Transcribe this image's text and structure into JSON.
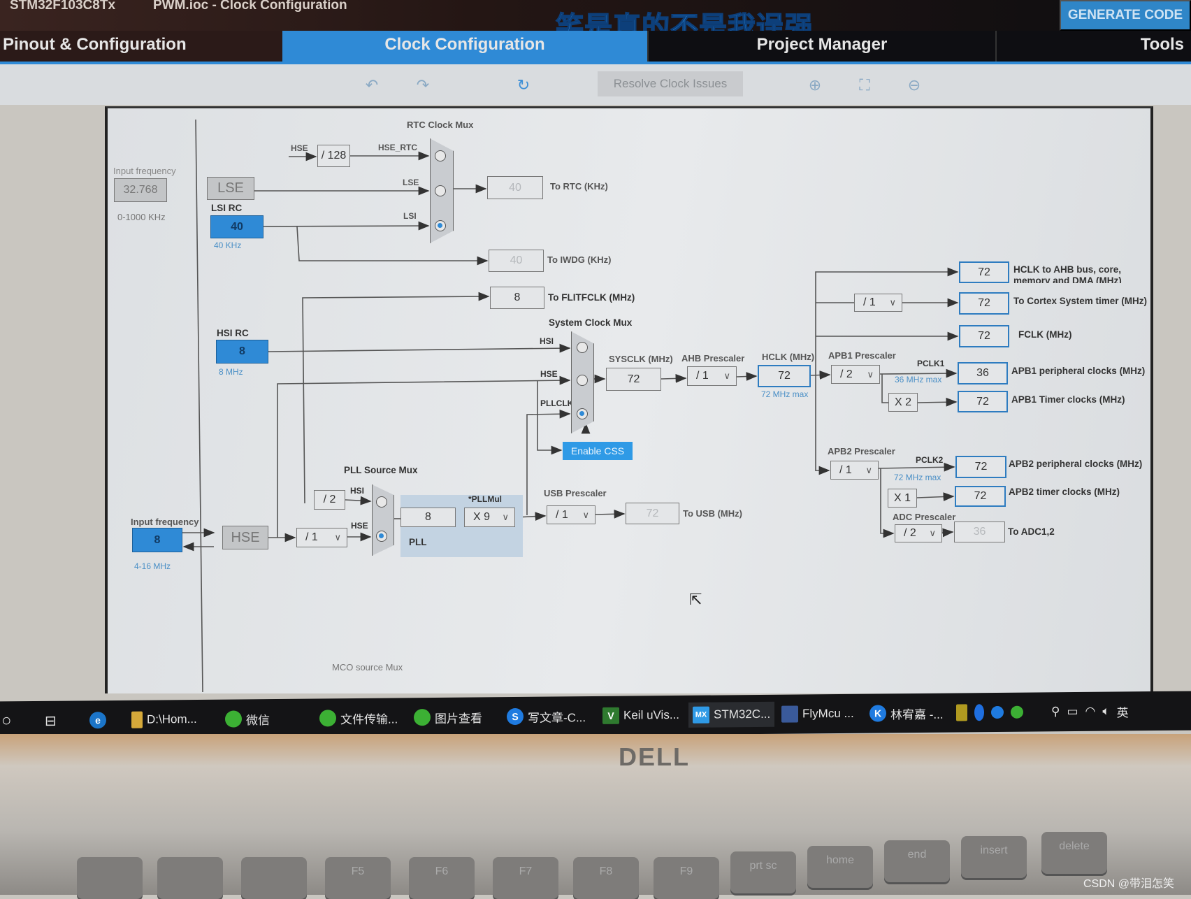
{
  "window": {
    "breadcrumb": [
      "STM32F103C8Tx",
      "PWM.ioc - Clock Configuration"
    ],
    "generate_code": "GENERATE CODE",
    "overlay_caption": "笑是真的不是我逞强"
  },
  "tabs": [
    {
      "label": "Pinout & Configuration",
      "active": false
    },
    {
      "label": "Clock Configuration",
      "active": true
    },
    {
      "label": "Project Manager",
      "active": false
    },
    {
      "label": "Tools",
      "active": false
    }
  ],
  "toolbar": {
    "icons": [
      "undo-icon",
      "redo-icon",
      "refresh-icon",
      "zoom-in-icon",
      "fit-screen-icon",
      "zoom-out-icon"
    ],
    "resolve_label": "Resolve Clock Issues"
  },
  "diagram": {
    "lse_input": {
      "label": "Input frequency",
      "value": "32.768",
      "range": "0-1000 KHz",
      "block": "LSE"
    },
    "lsi": {
      "label": "LSI RC",
      "value": "40",
      "unit": "40 KHz"
    },
    "rtc_mux": {
      "label": "RTC Clock Mux",
      "hse_label": "HSE",
      "div": "/ 128",
      "hse_rtc": "HSE_RTC",
      "lse_label": "LSE",
      "lsi_label": "LSI",
      "selected": "LSI"
    },
    "rtc_out": {
      "value": "40",
      "label": "To RTC (KHz)"
    },
    "iwdg_out": {
      "value": "40",
      "label": "To IWDG (KHz)"
    },
    "flitf_out": {
      "value": "8",
      "label": "To FLITFCLK (MHz)"
    },
    "hsi": {
      "label": "HSI RC",
      "value": "8",
      "unit": "8 MHz"
    },
    "sys_mux": {
      "label": "System Clock Mux",
      "hsi": "HSI",
      "hse": "HSE",
      "pllclk": "PLLCLK",
      "selected": "PLLCLK"
    },
    "sysclk": {
      "label": "SYSCLK (MHz)",
      "value": "72"
    },
    "ahb": {
      "label": "AHB Prescaler",
      "value": "/ 1"
    },
    "hclk": {
      "label": "HCLK (MHz)",
      "value": "72",
      "max": "72 MHz max"
    },
    "enable_css": "Enable CSS",
    "pll_src": {
      "label": "PLL Source Mux",
      "hsi": "HSI",
      "hse": "HSE",
      "hsi_div": "/ 2",
      "selected": "HSE"
    },
    "pll": {
      "label": "PLL",
      "input": "8",
      "mul_label": "*PLLMul",
      "mul": "X 9"
    },
    "usb": {
      "label": "USB Prescaler",
      "value": "/ 1",
      "out": "72",
      "out_label": "To USB (MHz)"
    },
    "hse_input": {
      "label": "Input frequency",
      "value": "8",
      "range": "4-16 MHz",
      "block": "HSE",
      "div": "/ 1"
    },
    "mco_label": "MCO source Mux",
    "outputs": {
      "ahb": {
        "value": "72",
        "label1": "HCLK to AHB bus, core,",
        "label2": "memory and DMA (MHz)"
      },
      "cortex": {
        "div": "/ 1",
        "value": "72",
        "label": "To Cortex System timer (MHz)"
      },
      "fclk": {
        "value": "72",
        "label": "FCLK (MHz)"
      },
      "apb1": {
        "label": "APB1 Prescaler",
        "div": "/ 2",
        "pclk": "PCLK1",
        "max": "36 MHz max",
        "value": "36",
        "out_label": "APB1 peripheral clocks (MHz)",
        "timer_mul": "X 2",
        "timer_value": "72",
        "timer_label": "APB1 Timer clocks (MHz)"
      },
      "apb2": {
        "label": "APB2 Prescaler",
        "div": "/ 1",
        "pclk": "PCLK2",
        "max": "72 MHz max",
        "value": "72",
        "out_label": "APB2 peripheral clocks (MHz)",
        "timer_mul": "X 1",
        "timer_value": "72",
        "timer_label": "APB2 timer clocks (MHz)"
      },
      "adc": {
        "label": "ADC Prescaler",
        "div": "/ 2",
        "value": "36",
        "out_label": "To ADC1,2"
      }
    }
  },
  "taskbar": {
    "items": [
      "D:\\Hom...",
      "微信",
      "文件传输...",
      "图片查看",
      "写文章-C...",
      "Keil uVis...",
      "STM32C...",
      "FlyMcu ...",
      "林宥嘉 -..."
    ],
    "active": "STM32C...",
    "mx_badge": "MX",
    "ime": "英"
  },
  "laptop": {
    "brand": "DELL",
    "keys": [
      "F5",
      "F6",
      "F7",
      "F8",
      "F9",
      "prt sc",
      "home",
      "end",
      "insert",
      "delete"
    ]
  },
  "watermark": "CSDN @带泪怎笑",
  "colors": {
    "accent": "#2f8ad6",
    "active_tab": "#2f8ad6",
    "taskbar": "#141416"
  }
}
